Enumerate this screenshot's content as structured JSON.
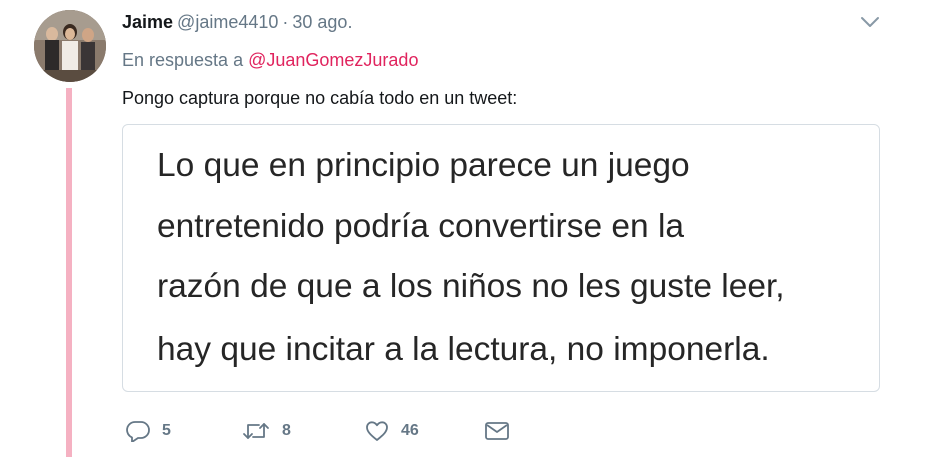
{
  "author": {
    "name": "Jaime",
    "handle": "@jaime4410",
    "separator": "·",
    "date": "30 ago."
  },
  "reply_context": {
    "prefix": "En respuesta a",
    "mention": "@JuanGomezJurado"
  },
  "tweet_text": "Pongo captura porque no cabía todo en un tweet:",
  "media": {
    "lines": [
      "Lo que en principio parece un juego",
      "entretenido podría convertirse en la",
      "razón de que a los niños no les guste leer,",
      "hay que incitar a la lectura, no imponerla."
    ]
  },
  "actions": {
    "reply_count": "5",
    "retweet_count": "8",
    "like_count": "46"
  },
  "icons": {
    "menu": "chevron-down-icon",
    "reply": "reply-icon",
    "retweet": "retweet-icon",
    "like": "heart-icon",
    "dm": "envelope-icon"
  },
  "colors": {
    "thread_line": "#f5b1c2",
    "mention": "#e0245e",
    "secondary_text": "#657786",
    "primary_text": "#14171a"
  }
}
